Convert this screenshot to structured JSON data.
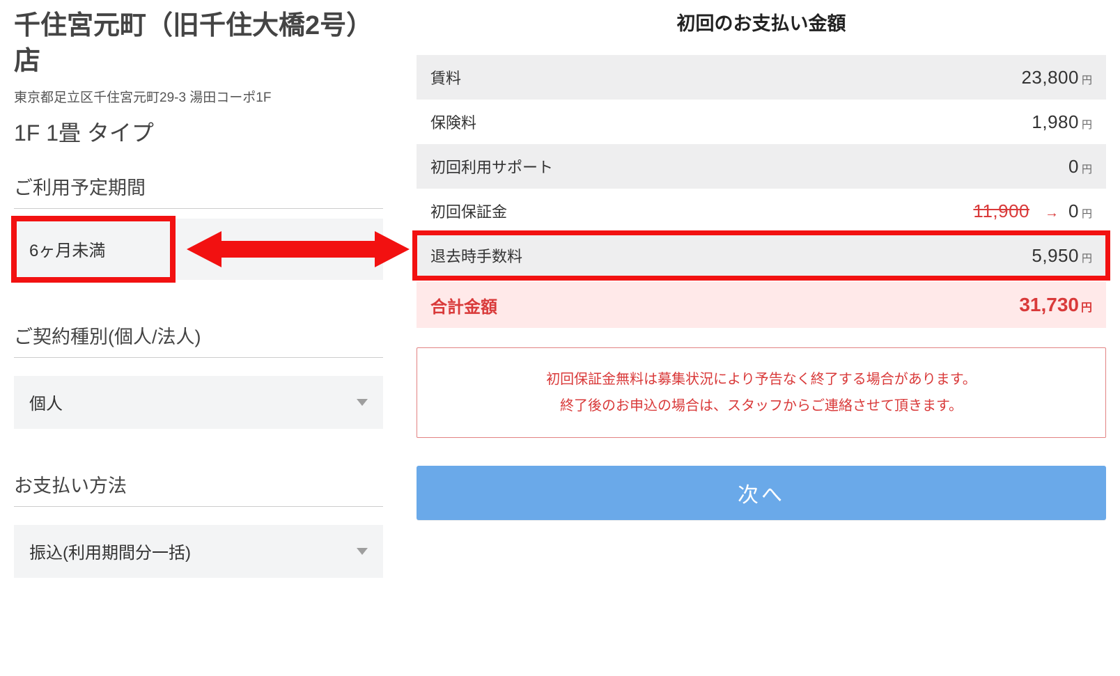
{
  "left": {
    "store_name": "千住宮元町（旧千住大橋2号）店",
    "store_address": "東京都足立区千住宮元町29-3 湯田コーポ1F",
    "room_type": "1F 1畳 タイプ",
    "sections": {
      "period_label": "ご利用予定期間",
      "period_value": "6ヶ月未満",
      "contract_label": "ご契約種別(個人/法人)",
      "contract_value": "個人",
      "payment_label": "お支払い方法",
      "payment_value": "振込(利用期間分一括)"
    }
  },
  "right": {
    "title": "初回のお支払い金額",
    "rows": {
      "r1": {
        "label": "賃料",
        "value": "23,800"
      },
      "r2": {
        "label": "保険料",
        "value": "1,980"
      },
      "r3": {
        "label": "初回利用サポート",
        "value": "0"
      },
      "r4": {
        "label": "初回保証金",
        "strike": "11,900",
        "value": "0"
      },
      "r5": {
        "label": "退去時手数料",
        "value": "5,950"
      }
    },
    "yen_unit": "円",
    "total": {
      "label": "合計金額",
      "value": "31,730"
    },
    "notice_line1": "初回保証金無料は募集状況により予告なく終了する場合があります。",
    "notice_line2": "終了後のお申込の場合は、スタッフからご連絡させて頂きます。",
    "next_button": "次へ"
  },
  "annotations": {
    "highlight_period": true,
    "highlight_moveout_fee_row": true,
    "double_arrow_between": true
  }
}
